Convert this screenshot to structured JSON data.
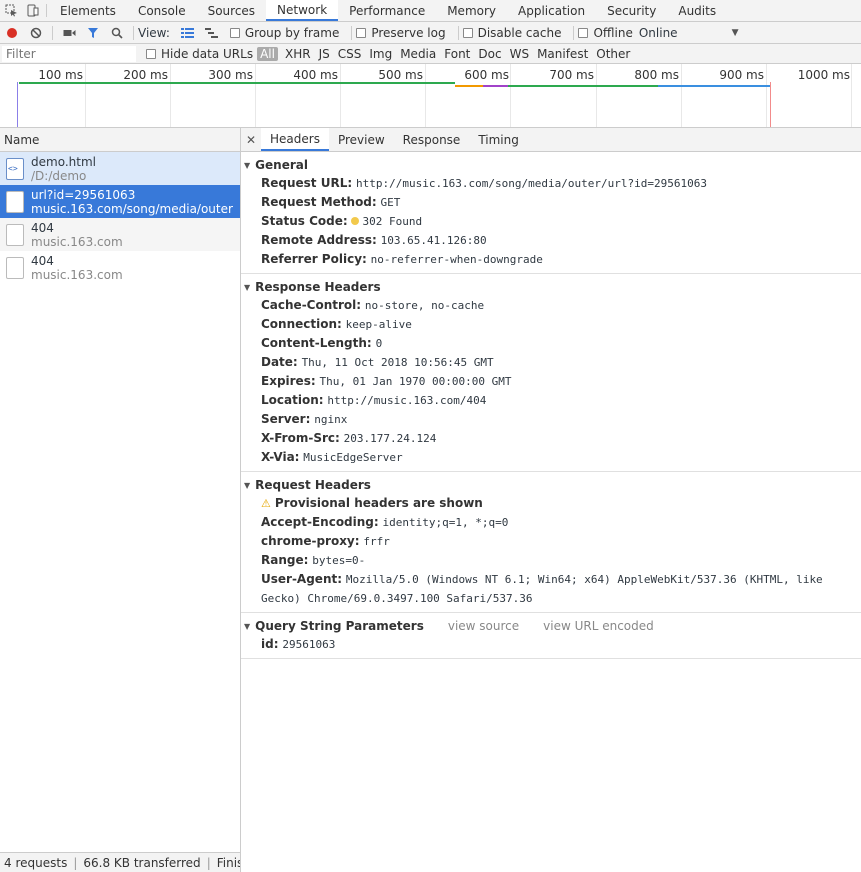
{
  "tabs": [
    "Elements",
    "Console",
    "Sources",
    "Network",
    "Performance",
    "Memory",
    "Application",
    "Security",
    "Audits"
  ],
  "active_tab": "Network",
  "toolbar": {
    "view_label": "View:",
    "group_by_frame": "Group by frame",
    "preserve_log": "Preserve log",
    "disable_cache": "Disable cache",
    "offline": "Offline",
    "throttle": "Online",
    "record_color": "#d93025"
  },
  "filter": {
    "placeholder": "Filter",
    "hide_data_urls": "Hide data URLs",
    "types": [
      "All",
      "XHR",
      "JS",
      "CSS",
      "Img",
      "Media",
      "Font",
      "Doc",
      "WS",
      "Manifest",
      "Other"
    ]
  },
  "overview": {
    "ticks": [
      "100 ms",
      "200 ms",
      "300 ms",
      "400 ms",
      "500 ms",
      "600 ms",
      "700 ms",
      "800 ms",
      "900 ms",
      "1000 ms"
    ]
  },
  "list": {
    "header": "Name",
    "requests": [
      {
        "name": "demo.html",
        "sub": "/D:/demo"
      },
      {
        "name": "url?id=29561063",
        "sub": "music.163.com/song/media/outer"
      },
      {
        "name": "404",
        "sub": "music.163.com"
      },
      {
        "name": "404",
        "sub": "music.163.com"
      }
    ]
  },
  "status": {
    "requests": "4 requests",
    "transferred": "66.8 KB transferred",
    "finish": "Finish: ..."
  },
  "detail_tabs": [
    "Headers",
    "Preview",
    "Response",
    "Timing"
  ],
  "general": {
    "title": "General",
    "request_url_k": "Request URL:",
    "request_url_v": "http://music.163.com/song/media/outer/url?id=29561063",
    "method_k": "Request Method:",
    "method_v": "GET",
    "status_k": "Status Code:",
    "status_v": "302 Found",
    "remote_k": "Remote Address:",
    "remote_v": "103.65.41.126:80",
    "referrer_k": "Referrer Policy:",
    "referrer_v": "no-referrer-when-downgrade"
  },
  "response_headers": {
    "title": "Response Headers",
    "items": [
      {
        "k": "Cache-Control:",
        "v": "no-store, no-cache"
      },
      {
        "k": "Connection:",
        "v": "keep-alive"
      },
      {
        "k": "Content-Length:",
        "v": "0"
      },
      {
        "k": "Date:",
        "v": "Thu, 11 Oct 2018 10:56:45 GMT"
      },
      {
        "k": "Expires:",
        "v": "Thu, 01 Jan 1970 00:00:00 GMT"
      },
      {
        "k": "Location:",
        "v": "http://music.163.com/404"
      },
      {
        "k": "Server:",
        "v": "nginx"
      },
      {
        "k": "X-From-Src:",
        "v": "203.177.24.124"
      },
      {
        "k": "X-Via:",
        "v": "MusicEdgeServer"
      }
    ]
  },
  "request_headers": {
    "title": "Request Headers",
    "provisional": "Provisional headers are shown",
    "items": [
      {
        "k": "Accept-Encoding:",
        "v": "identity;q=1, *;q=0"
      },
      {
        "k": "chrome-proxy:",
        "v": "frfr"
      },
      {
        "k": "Range:",
        "v": "bytes=0-"
      },
      {
        "k": "User-Agent:",
        "v": "Mozilla/5.0 (Windows NT 6.1; Win64; x64) AppleWebKit/537.36 (KHTML, like Gecko) Chrome/69.0.3497.100 Safari/537.36"
      }
    ]
  },
  "query": {
    "title": "Query String Parameters",
    "view_source": "view source",
    "view_url_encoded": "view URL encoded",
    "id_k": "id:",
    "id_v": "29561063"
  },
  "colors": {
    "accent": "#3879d9",
    "selected_row": "#3879d9",
    "status_dot": "#f2c94c"
  }
}
